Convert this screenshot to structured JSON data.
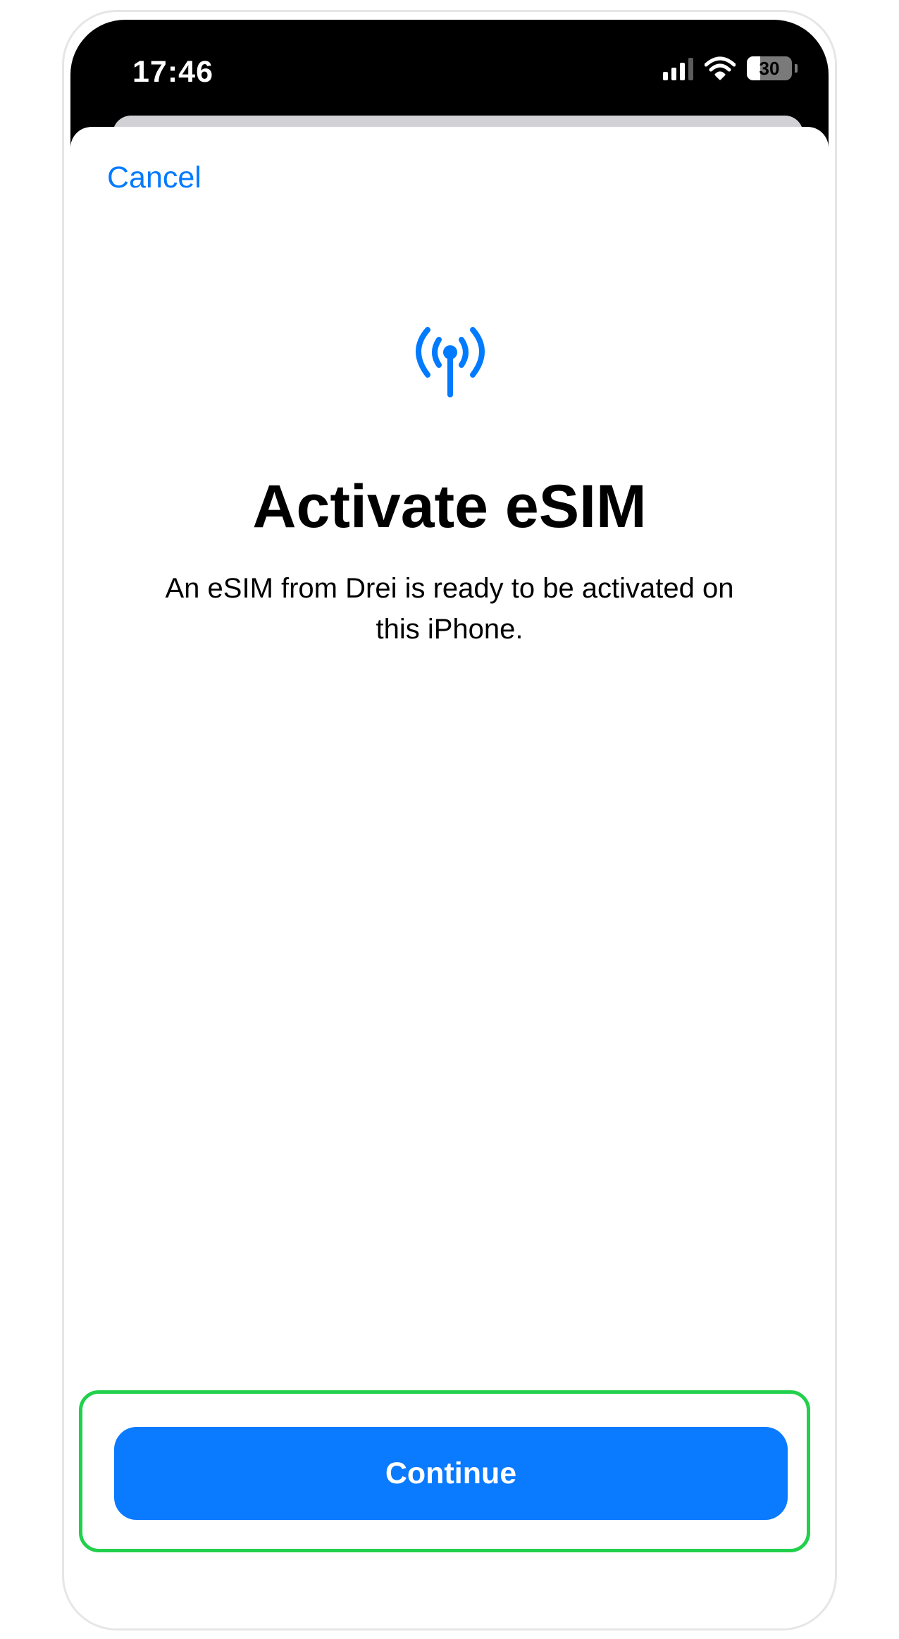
{
  "status_bar": {
    "time": "17:46",
    "battery_level": "30",
    "icons": [
      "cellular-signal-icon",
      "wifi-icon",
      "battery-icon"
    ]
  },
  "nav": {
    "cancel_label": "Cancel"
  },
  "content": {
    "icon": "antenna-signal-icon",
    "title": "Activate eSIM",
    "subtitle": "An eSIM from Drei is ready to be activated on this iPhone."
  },
  "footer": {
    "continue_label": "Continue"
  },
  "colors": {
    "accent": "#007AFF",
    "button": "#0A7AFF",
    "highlight": "#21D04B"
  }
}
